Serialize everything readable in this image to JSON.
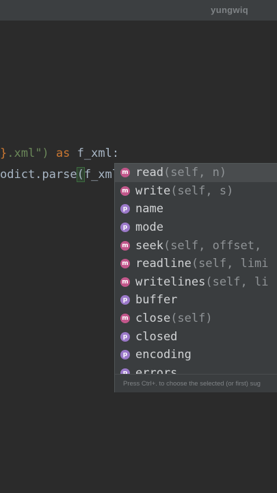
{
  "watermark": "yungwiq",
  "editor": {
    "line1": {
      "brace": "}",
      "string": ".xml\")",
      "space1": " ",
      "keyword": "as",
      "rest": " f_xml:"
    },
    "line2": {
      "prefix": "odict.parse",
      "paren": "(",
      "rest": "f_xml."
    }
  },
  "completion": {
    "items": [
      {
        "kind": "m",
        "name": "read",
        "sig": "(self, n)"
      },
      {
        "kind": "m",
        "name": "write",
        "sig": "(self, s)"
      },
      {
        "kind": "p",
        "name": "name",
        "sig": ""
      },
      {
        "kind": "p",
        "name": "mode",
        "sig": ""
      },
      {
        "kind": "m",
        "name": "seek",
        "sig": "(self, offset,"
      },
      {
        "kind": "m",
        "name": "readline",
        "sig": "(self, limi"
      },
      {
        "kind": "m",
        "name": "writelines",
        "sig": "(self, li"
      },
      {
        "kind": "p",
        "name": "buffer",
        "sig": ""
      },
      {
        "kind": "m",
        "name": "close",
        "sig": "(self)"
      },
      {
        "kind": "p",
        "name": "closed",
        "sig": ""
      },
      {
        "kind": "p",
        "name": "encoding",
        "sig": ""
      },
      {
        "kind": "p",
        "name": "errors",
        "sig": ""
      }
    ],
    "selected_index": 0,
    "hint": "Press Ctrl+. to choose the selected (or first) sug"
  }
}
